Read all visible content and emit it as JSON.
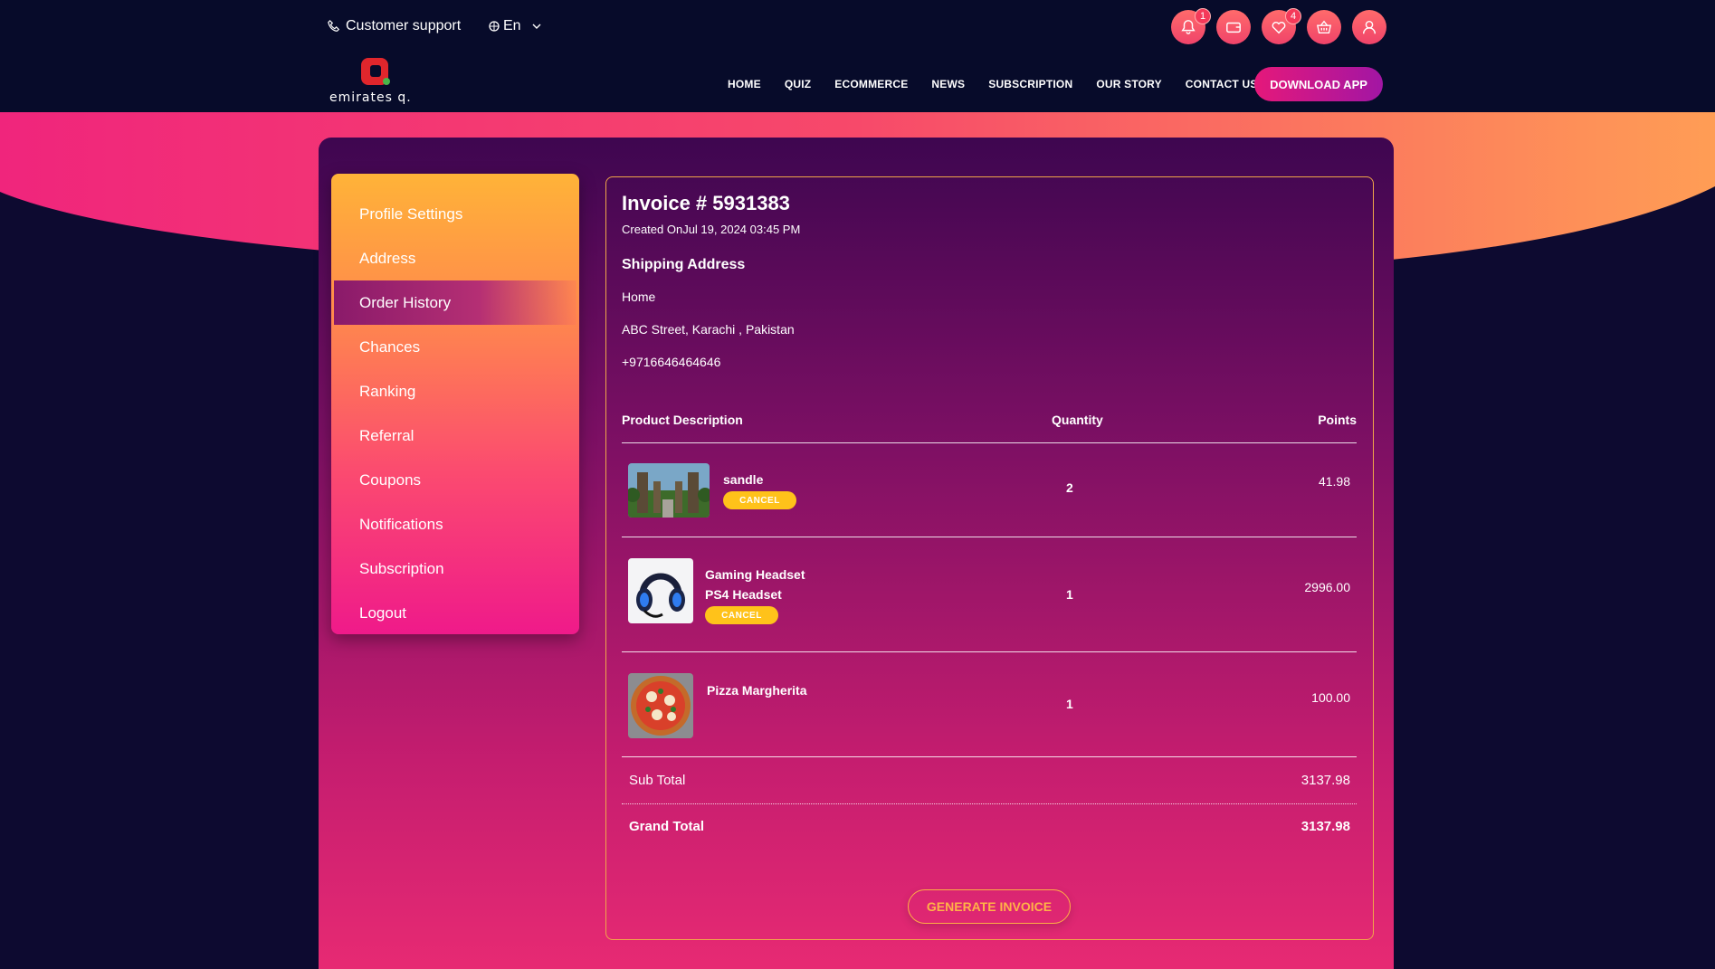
{
  "header": {
    "support_label": "Customer support",
    "language": "En",
    "notification_count": "1",
    "wishlist_count": "4",
    "logo_text": "emirates q.",
    "nav": [
      "HOME",
      "QUIZ",
      "ECOMMERCE",
      "NEWS",
      "SUBSCRIPTION",
      "OUR STORY",
      "CONTACT US"
    ],
    "download_label": "DOWNLOAD APP"
  },
  "sidebar": {
    "items": [
      {
        "label": "Profile Settings",
        "active": false
      },
      {
        "label": "Address",
        "active": false
      },
      {
        "label": "Order History",
        "active": true
      },
      {
        "label": "Chances",
        "active": false
      },
      {
        "label": "Ranking",
        "active": false
      },
      {
        "label": "Referral",
        "active": false
      },
      {
        "label": "Coupons",
        "active": false
      },
      {
        "label": "Notifications",
        "active": false
      },
      {
        "label": "Subscription",
        "active": false
      },
      {
        "label": "Logout",
        "active": false
      }
    ]
  },
  "invoice": {
    "title": "Invoice # 5931383",
    "created": "Created OnJul 19, 2024 03:45 PM",
    "shipping_title": "Shipping Address",
    "shipping_lines": [
      "Home",
      "ABC Street, Karachi , Pakistan",
      "+9716646464646"
    ],
    "columns": {
      "product": "Product Description",
      "quantity": "Quantity",
      "points": "Points"
    },
    "items": [
      {
        "name_line1": "sandle",
        "name_line2": "",
        "quantity": "2",
        "points": "41.98",
        "cancel_label": "CANCEL",
        "thumb": "gate-photo"
      },
      {
        "name_line1": "Gaming Headset",
        "name_line2": "PS4 Headset",
        "quantity": "1",
        "points": "2996.00",
        "cancel_label": "CANCEL",
        "thumb": "headset-photo"
      },
      {
        "name_line1": "Pizza Margherita",
        "name_line2": "",
        "quantity": "1",
        "points": "100.00",
        "cancel_label": "",
        "thumb": "pizza-photo"
      }
    ],
    "subtotal_label": "Sub Total",
    "subtotal_value": "3137.98",
    "grandtotal_label": "Grand Total",
    "grandtotal_value": "3137.98",
    "generate_label": "GENERATE INVOICE"
  },
  "colors": {
    "header_bg": "#070b2a",
    "accent_orange": "#ffb338",
    "accent_pink": "#ef1a8a",
    "cancel_yellow": "#ffc21a"
  }
}
